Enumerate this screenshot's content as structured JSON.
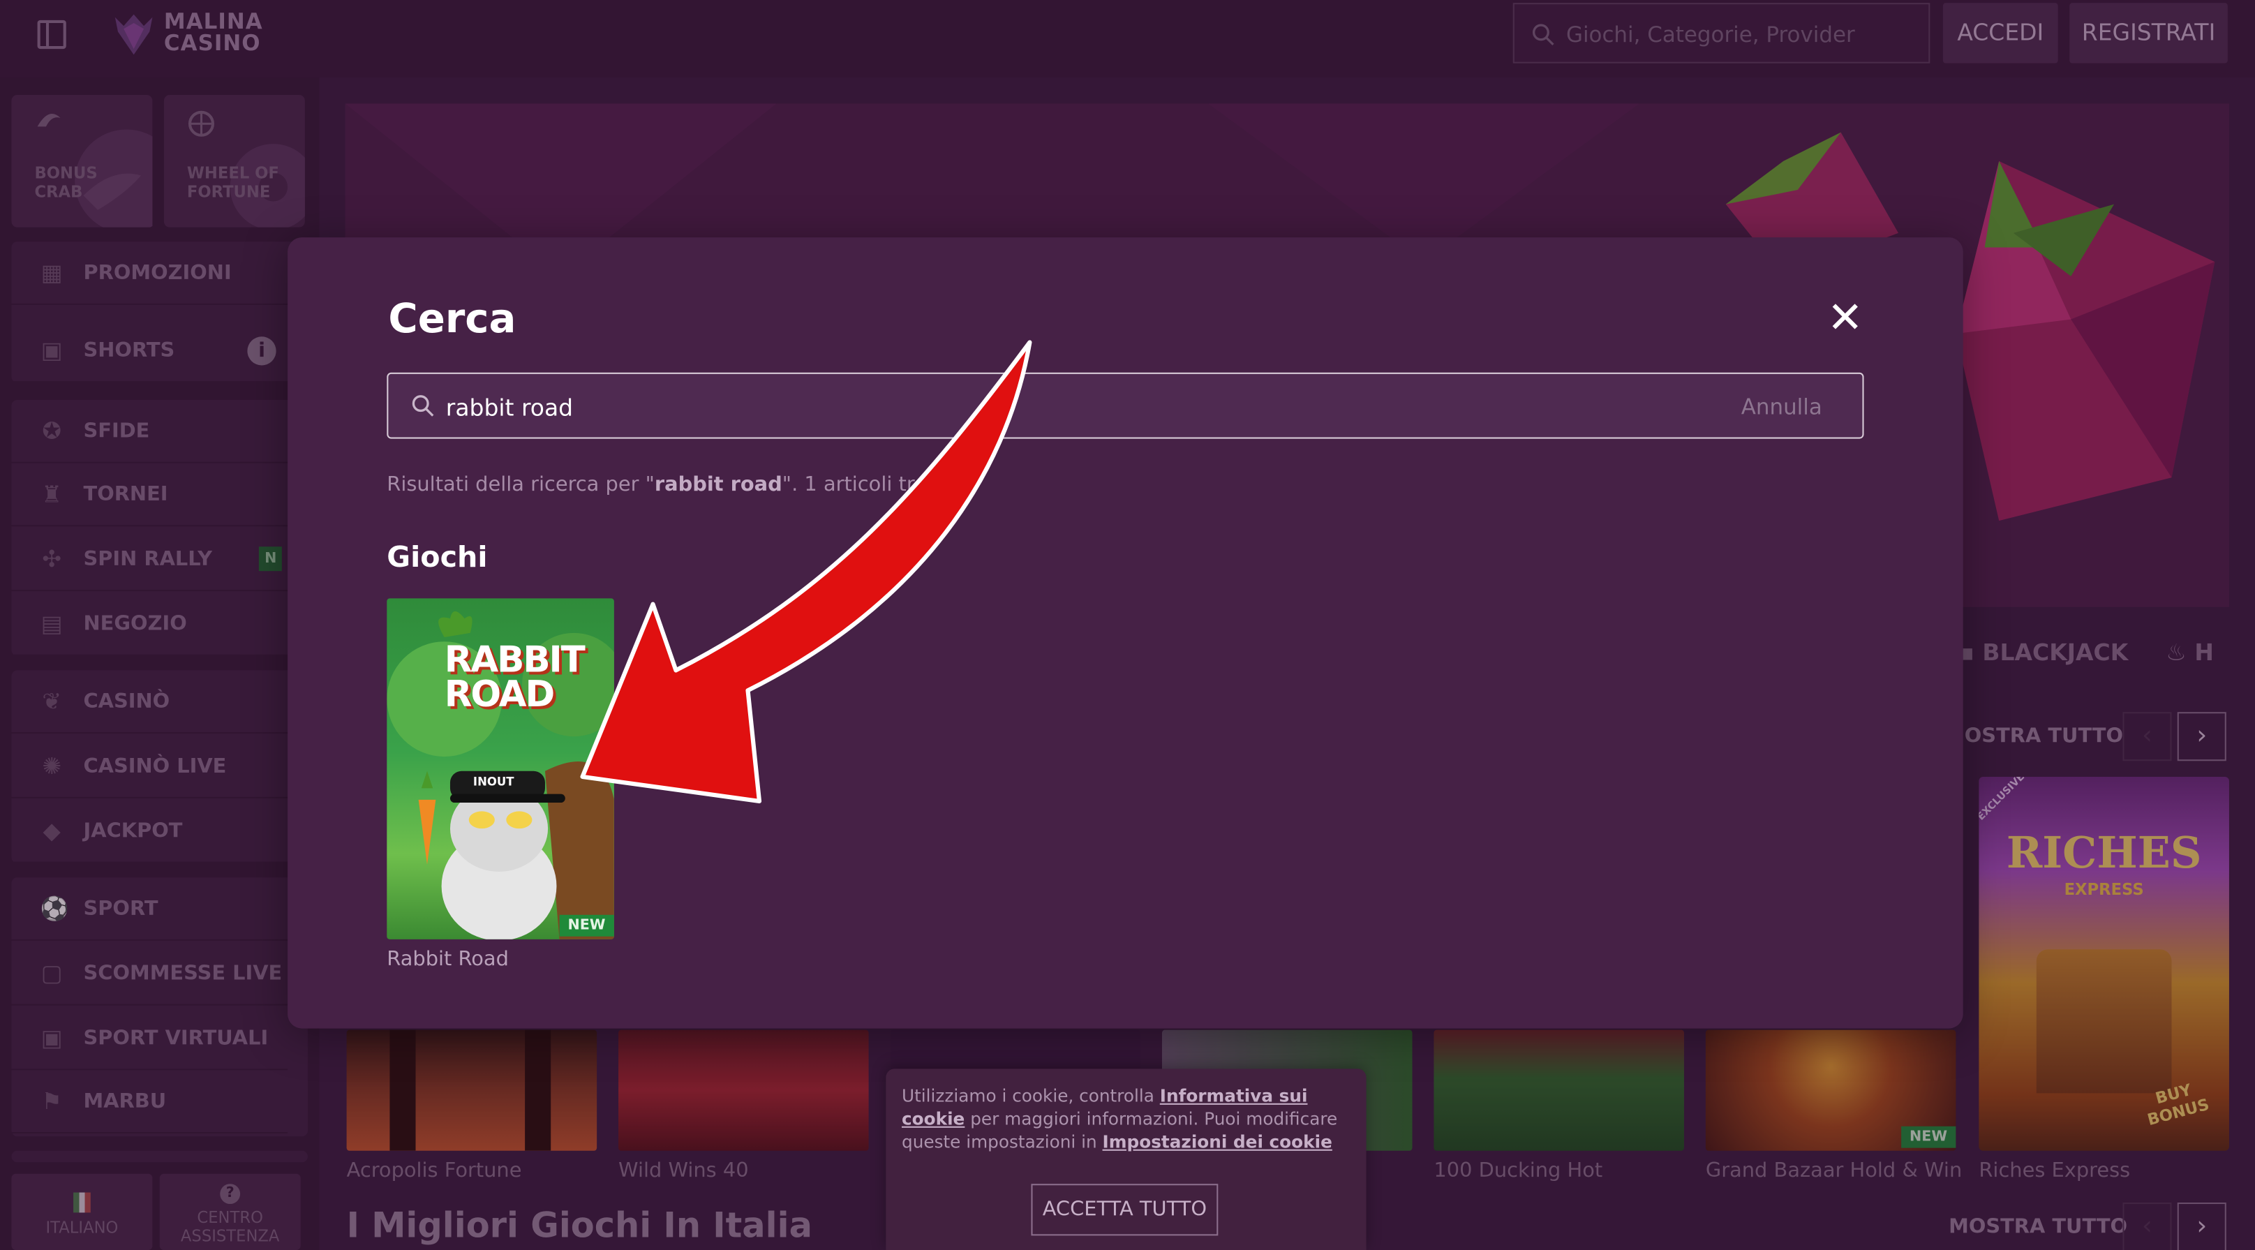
{
  "header": {
    "logo_line1": "MALINA",
    "logo_line2": "CASINO",
    "search_placeholder": "Giochi, Categorie, Provider",
    "login_label": "ACCEDI",
    "register_label": "REGISTRATI"
  },
  "sidebar": {
    "tiles": [
      {
        "label1": "BONUS",
        "label2": "CRAB"
      },
      {
        "label1": "WHEEL OF",
        "label2": "FORTUNE"
      }
    ],
    "group1": [
      {
        "label": "PROMOZIONI",
        "icon": "gift-icon"
      },
      {
        "label": "SHORTS",
        "icon": "video-icon"
      }
    ],
    "group2": [
      {
        "label": "SFIDE",
        "icon": "medal-icon"
      },
      {
        "label": "TORNEI",
        "icon": "trophy-icon"
      },
      {
        "label": "SPIN RALLY",
        "icon": "rally-icon"
      },
      {
        "label": "NEGOZIO",
        "icon": "shop-icon"
      }
    ],
    "group3": [
      {
        "label": "CASINÒ",
        "icon": "cherry-icon"
      },
      {
        "label": "CASINÒ LIVE",
        "icon": "chip-icon"
      },
      {
        "label": "JACKPOT",
        "icon": "jackpot-icon"
      }
    ],
    "group4": [
      {
        "label": "SPORT",
        "icon": "ball-icon"
      },
      {
        "label": "SCOMMESSE LIVE",
        "icon": "live-bet-icon"
      },
      {
        "label": "SPORT VIRTUALI",
        "icon": "virtual-sport-icon"
      },
      {
        "label": "MARBU",
        "icon": "flag-icon"
      }
    ],
    "spin_rally_badge": "N",
    "bottom": [
      {
        "label": "ITALIANO"
      },
      {
        "label1": "CENTRO",
        "label2": "ASSISTENZA"
      }
    ]
  },
  "main": {
    "categories": [
      "BLACKJACK",
      "H"
    ],
    "show_all": "OSTRA TUTTO",
    "show_all_bottom": "MOSTRA TUTTO",
    "games": [
      "Acropolis Fortune",
      "Wild Wins 40",
      "100 Ducking Hot",
      "Grand Bazaar Hold & Win",
      "Riches Express"
    ],
    "new_badge": "NEW",
    "section_title": "I Migliori Giochi In Italia",
    "riches_title": "RICHES",
    "riches_sub": "EXPRESS",
    "riches_exclusive": "EXCLUSIVE",
    "riches_bonus": "BUY BONUS"
  },
  "search_modal": {
    "title": "Cerca",
    "query": "rabbit road",
    "cancel": "Annulla",
    "results_prefix": "Risultati della ricerca per \"",
    "results_query": "rabbit road",
    "results_suffix": "\". 1 articoli trovati.",
    "section": "Giochi",
    "result": {
      "name": "Rabbit Road",
      "art_title1": "RABBIT",
      "art_title2": "ROAD",
      "art_cap": "INOUT",
      "badge": "NEW"
    }
  },
  "cookie": {
    "text1": "Utilizziamo i cookie, controlla ",
    "link1": "Informativa sui cookie",
    "text2": " per maggiori informazioni. Puoi modificare queste impostazioni in ",
    "link2": "Impostazioni dei cookie",
    "accept": "ACCETTA TUTTO"
  },
  "colors": {
    "background": "#3d1d3f",
    "modal": "#462146",
    "arrow": "#e01010",
    "new_badge": "#1f8a3a"
  }
}
